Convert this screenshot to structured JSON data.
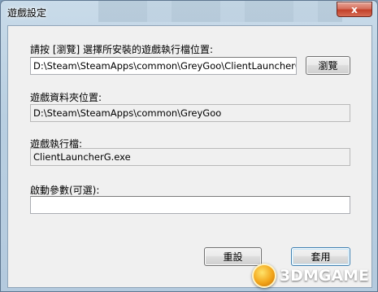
{
  "window": {
    "title": "遊戲設定",
    "close_glyph": "x"
  },
  "main": {
    "exe_prompt": "請按 [瀏覽] 選擇所安裝的遊戲執行檔位置:",
    "exe_path": "D:\\Steam\\SteamApps\\common\\GreyGoo\\ClientLauncherG.exe",
    "browse_label": "瀏覽",
    "folder_label": "遊戲資料夾位置:",
    "folder_path": "D:\\Steam\\SteamApps\\common\\GreyGoo",
    "exe_label": "遊戲執行檔:",
    "exe_name": "ClientLauncherG.exe",
    "args_label": "啟動參數(可選):",
    "args_value": ""
  },
  "footer": {
    "reset_label": "重設",
    "apply_label": "套用"
  },
  "watermark": {
    "text": "3DMGAME"
  }
}
